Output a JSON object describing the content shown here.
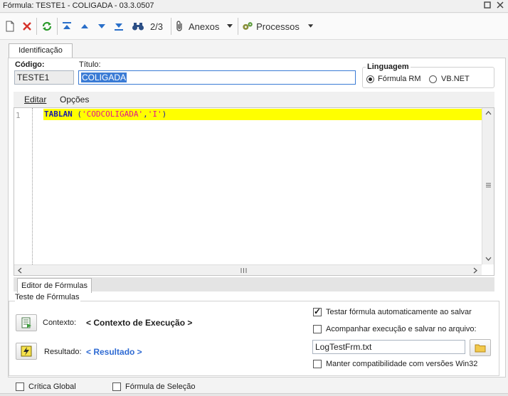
{
  "window": {
    "title": "Fórmula: TESTE1 - COLIGADA - 03.3.0507"
  },
  "toolbar": {
    "pager": "2/3",
    "attachments_label": "Anexos",
    "processes_label": "Processos"
  },
  "tab": {
    "identification": "Identificação"
  },
  "fields": {
    "code_label": "Código:",
    "code_value": "TESTE1",
    "title_label": "Título:",
    "title_value": "COLIGADA"
  },
  "language": {
    "label": "Linguagem",
    "options": [
      {
        "label": "Fórmula RM",
        "selected": true
      },
      {
        "label": "VB.NET",
        "selected": false
      }
    ]
  },
  "editor": {
    "menu": [
      "Editar",
      "Opções"
    ],
    "line_number": "1",
    "code": {
      "keyword": "TABLAN",
      "open": " (",
      "arg1": "'CODCOLIGADA'",
      "comma": ",",
      "arg2": "'I'",
      "close": ")"
    },
    "keyword_color": "#1a1aa6",
    "string_color": "#e0168c",
    "highlight_color": "#ffff00"
  },
  "editor_tab": "Editor de Fórmulas",
  "test": {
    "group_label": "Teste de Fórmulas",
    "context_label": "Contexto:",
    "context_value": "< Contexto de Execução >",
    "result_label": "Resultado:",
    "result_value": "< Resultado >",
    "auto_test_label": "Testar fórmula automaticamente ao salvar",
    "auto_test_checked": true,
    "follow_label": "Acompanhar execução e salvar no arquivo:",
    "follow_checked": false,
    "log_file": "LogTestFrm.txt",
    "compat_label": "Manter compatibilidade com versões Win32",
    "compat_checked": false
  },
  "footer": {
    "global_critical": "Crítica Global",
    "selection_formula": "Fórmula de Seleção"
  }
}
